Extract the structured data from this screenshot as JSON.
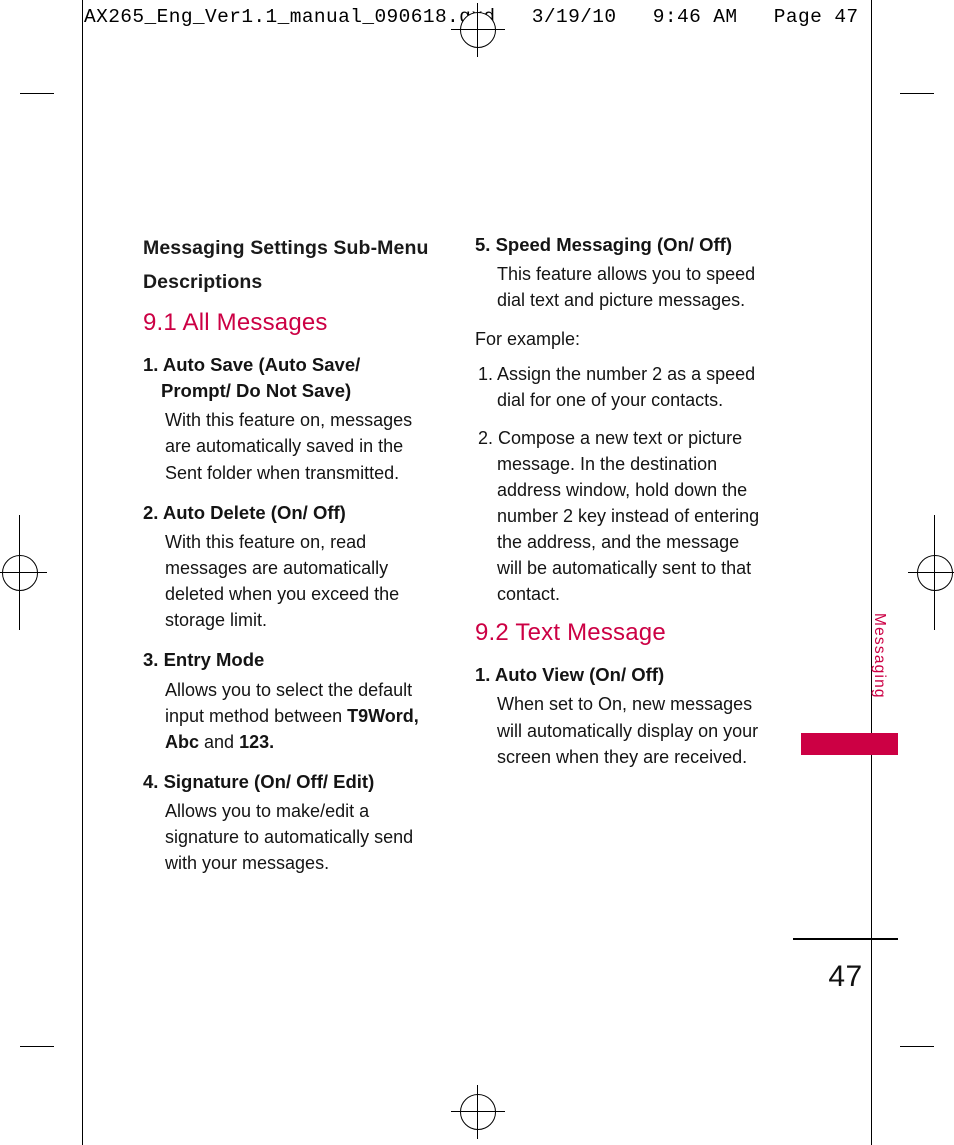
{
  "print_header": "AX265_Eng_Ver1.1_manual_090618.qxd   3/19/10   9:46 AM   Page 47",
  "side_tab": {
    "label": "Messaging",
    "accent_color": "#cc0044"
  },
  "page_number": "47",
  "left_column": {
    "sub_heading": "Messaging Settings Sub-Menu Descriptions",
    "section_title": "9.1 All Messages",
    "items": [
      {
        "title": "1. Auto Save (Auto Save/ Prompt/ Do Not Save)",
        "body": "With this feature on, messages are automatically saved in the Sent folder when transmitted."
      },
      {
        "title": "2. Auto Delete (On/ Off)",
        "body": "With this feature on, read messages are automatically deleted when you exceed the storage limit."
      },
      {
        "title": "3. Entry Mode",
        "body_pre": "Allows you to select the default input method between ",
        "body_bold_1": "T9Word, Abc",
        "body_mid": " and ",
        "body_bold_2": "123.",
        "body_post": ""
      },
      {
        "title": "4. Signature (On/ Off/ Edit)",
        "body": "Allows you to make/edit a signature to automatically send with your messages."
      }
    ]
  },
  "right_column": {
    "item_speed": {
      "title": "5. Speed Messaging (On/ Off)",
      "body": "This feature allows you to speed dial text and picture messages."
    },
    "for_example": "For example:",
    "examples": [
      "1. Assign the number 2  as a speed dial for one of your contacts.",
      "2. Compose a new text or picture message. In the destination address window, hold down the number 2 key instead of entering the address, and the message will be automatically sent to that contact."
    ],
    "section_title": "9.2 Text Message",
    "item_autoview": {
      "title": "1. Auto View (On/ Off)",
      "body": "When set to On, new messages will automatically display on your screen when they are received."
    }
  }
}
